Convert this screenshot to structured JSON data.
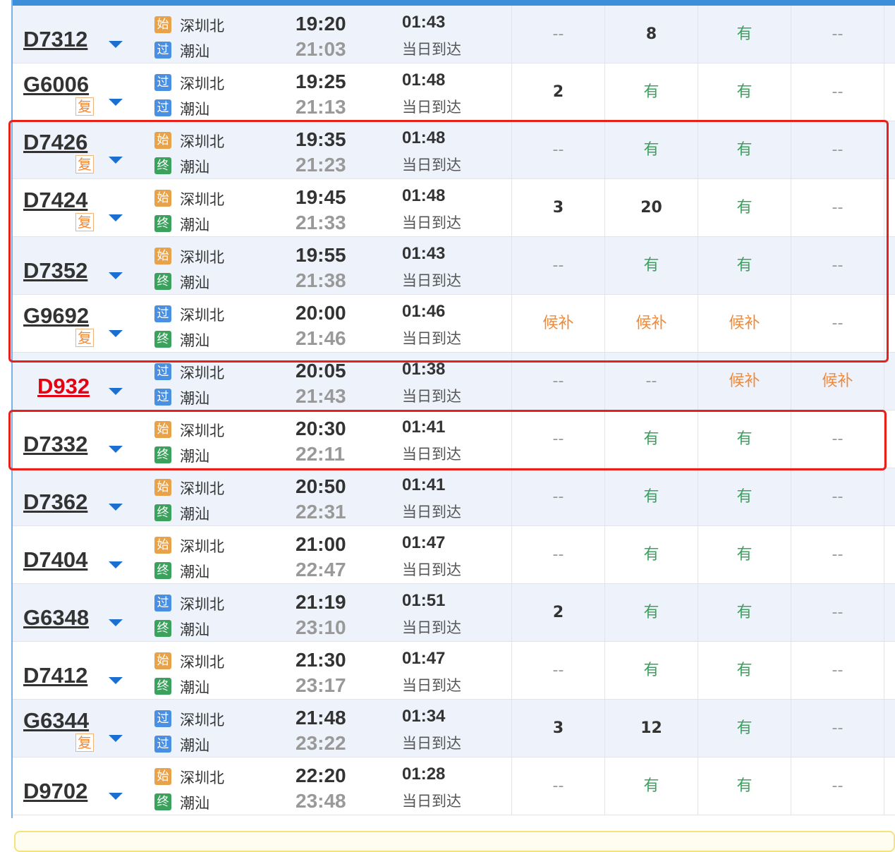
{
  "trains": [
    {
      "number": "D7312",
      "fu": "",
      "from_badge": "始",
      "from_badge_color": "orange",
      "from": "深圳北",
      "to_badge": "过",
      "to_badge_color": "blue",
      "to": "潮汕",
      "depart": "19:20",
      "arrive": "21:03",
      "duration": "01:43",
      "arrival_note": "当日到达",
      "seats": [
        "--",
        "8",
        "有",
        "--"
      ],
      "red": false
    },
    {
      "number": "G6006",
      "fu": "复",
      "from_badge": "过",
      "from_badge_color": "blue",
      "from": "深圳北",
      "to_badge": "过",
      "to_badge_color": "blue",
      "to": "潮汕",
      "depart": "19:25",
      "arrive": "21:13",
      "duration": "01:48",
      "arrival_note": "当日到达",
      "seats": [
        "2",
        "有",
        "有",
        "--"
      ],
      "red": false
    },
    {
      "number": "D7426",
      "fu": "复",
      "from_badge": "始",
      "from_badge_color": "orange",
      "from": "深圳北",
      "to_badge": "终",
      "to_badge_color": "green",
      "to": "潮汕",
      "depart": "19:35",
      "arrive": "21:23",
      "duration": "01:48",
      "arrival_note": "当日到达",
      "seats": [
        "--",
        "有",
        "有",
        "--"
      ],
      "red": false
    },
    {
      "number": "D7424",
      "fu": "复",
      "from_badge": "始",
      "from_badge_color": "orange",
      "from": "深圳北",
      "to_badge": "终",
      "to_badge_color": "green",
      "to": "潮汕",
      "depart": "19:45",
      "arrive": "21:33",
      "duration": "01:48",
      "arrival_note": "当日到达",
      "seats": [
        "3",
        "20",
        "有",
        "--"
      ],
      "red": false
    },
    {
      "number": "D7352",
      "fu": "",
      "from_badge": "始",
      "from_badge_color": "orange",
      "from": "深圳北",
      "to_badge": "终",
      "to_badge_color": "green",
      "to": "潮汕",
      "depart": "19:55",
      "arrive": "21:38",
      "duration": "01:43",
      "arrival_note": "当日到达",
      "seats": [
        "--",
        "有",
        "有",
        "--"
      ],
      "red": false
    },
    {
      "number": "G9692",
      "fu": "复",
      "from_badge": "过",
      "from_badge_color": "blue",
      "from": "深圳北",
      "to_badge": "终",
      "to_badge_color": "green",
      "to": "潮汕",
      "depart": "20:00",
      "arrive": "21:46",
      "duration": "01:46",
      "arrival_note": "当日到达",
      "seats": [
        "候补",
        "候补",
        "候补",
        "--"
      ],
      "red": false
    },
    {
      "number": "D932",
      "fu": "",
      "from_badge": "过",
      "from_badge_color": "blue",
      "from": "深圳北",
      "to_badge": "过",
      "to_badge_color": "blue",
      "to": "潮汕",
      "depart": "20:05",
      "arrive": "21:43",
      "duration": "01:38",
      "arrival_note": "当日到达",
      "seats": [
        "--",
        "--",
        "候补",
        "候补"
      ],
      "red": true
    },
    {
      "number": "D7332",
      "fu": "",
      "from_badge": "始",
      "from_badge_color": "orange",
      "from": "深圳北",
      "to_badge": "终",
      "to_badge_color": "green",
      "to": "潮汕",
      "depart": "20:30",
      "arrive": "22:11",
      "duration": "01:41",
      "arrival_note": "当日到达",
      "seats": [
        "--",
        "有",
        "有",
        "--"
      ],
      "red": false
    },
    {
      "number": "D7362",
      "fu": "",
      "from_badge": "始",
      "from_badge_color": "orange",
      "from": "深圳北",
      "to_badge": "终",
      "to_badge_color": "green",
      "to": "潮汕",
      "depart": "20:50",
      "arrive": "22:31",
      "duration": "01:41",
      "arrival_note": "当日到达",
      "seats": [
        "--",
        "有",
        "有",
        "--"
      ],
      "red": false
    },
    {
      "number": "D7404",
      "fu": "",
      "from_badge": "始",
      "from_badge_color": "orange",
      "from": "深圳北",
      "to_badge": "终",
      "to_badge_color": "green",
      "to": "潮汕",
      "depart": "21:00",
      "arrive": "22:47",
      "duration": "01:47",
      "arrival_note": "当日到达",
      "seats": [
        "--",
        "有",
        "有",
        "--"
      ],
      "red": false
    },
    {
      "number": "G6348",
      "fu": "",
      "from_badge": "过",
      "from_badge_color": "blue",
      "from": "深圳北",
      "to_badge": "终",
      "to_badge_color": "green",
      "to": "潮汕",
      "depart": "21:19",
      "arrive": "23:10",
      "duration": "01:51",
      "arrival_note": "当日到达",
      "seats": [
        "2",
        "有",
        "有",
        "--"
      ],
      "red": false
    },
    {
      "number": "D7412",
      "fu": "",
      "from_badge": "始",
      "from_badge_color": "orange",
      "from": "深圳北",
      "to_badge": "终",
      "to_badge_color": "green",
      "to": "潮汕",
      "depart": "21:30",
      "arrive": "23:17",
      "duration": "01:47",
      "arrival_note": "当日到达",
      "seats": [
        "--",
        "有",
        "有",
        "--"
      ],
      "red": false
    },
    {
      "number": "G6344",
      "fu": "复",
      "from_badge": "过",
      "from_badge_color": "blue",
      "from": "深圳北",
      "to_badge": "过",
      "to_badge_color": "blue",
      "to": "潮汕",
      "depart": "21:48",
      "arrive": "23:22",
      "duration": "01:34",
      "arrival_note": "当日到达",
      "seats": [
        "3",
        "12",
        "有",
        "--"
      ],
      "red": false
    },
    {
      "number": "D9702",
      "fu": "",
      "from_badge": "始",
      "from_badge_color": "orange",
      "from": "深圳北",
      "to_badge": "终",
      "to_badge_color": "green",
      "to": "潮汕",
      "depart": "22:20",
      "arrive": "23:48",
      "duration": "01:28",
      "arrival_note": "当日到达",
      "seats": [
        "--",
        "有",
        "有",
        "--"
      ],
      "red": false
    }
  ],
  "colors": {
    "accent": "#3d8fd9",
    "highlight": "#e8201a",
    "available": "#3aa25c",
    "waitlist": "#f08a3a",
    "train_red": "#e60012"
  },
  "icons": {
    "expand": "chevron-down-icon"
  }
}
